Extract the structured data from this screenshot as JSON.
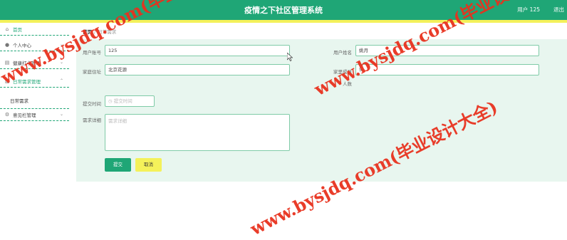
{
  "header": {
    "title": "疫情之下社区管理系统",
    "user_text": "用户 125",
    "logout_label": "退出"
  },
  "sidebar": {
    "items": [
      {
        "label": "首页",
        "icon": "home-icon"
      },
      {
        "label": "个人中心",
        "icon": "user-icon"
      },
      {
        "label": "健康打卡管理",
        "icon": "bank-icon"
      },
      {
        "label": "日常需求管理",
        "icon": "clipboard-icon"
      },
      {
        "label": "意见栏管理",
        "icon": "gear-icon"
      }
    ],
    "submenu": {
      "label": "日常需求"
    }
  },
  "breadcrumb": {
    "home": "首页",
    "separator": "/",
    "current": "日常需求"
  },
  "form": {
    "account_label": "用户账号",
    "account_value": "125",
    "name_label": "用户姓名",
    "name_value": "姚月",
    "address_label": "家庭住址",
    "address_value": "北京花源",
    "members_label": "家里成员",
    "members_value": "5",
    "people_label": "人数",
    "time_label": "提交时间",
    "time_placeholder": "提交时间",
    "detail_label": "需求详细",
    "detail_placeholder": "需求详细",
    "submit_label": "提交",
    "cancel_label": "取消"
  },
  "watermark": {
    "text": "www.bysjdq.com(毕业设计大全)"
  },
  "colors": {
    "primary": "#1fa676",
    "accent_yellow": "#f4f15a",
    "panel": "#e8f6ef",
    "watermark": "#e8321e"
  }
}
